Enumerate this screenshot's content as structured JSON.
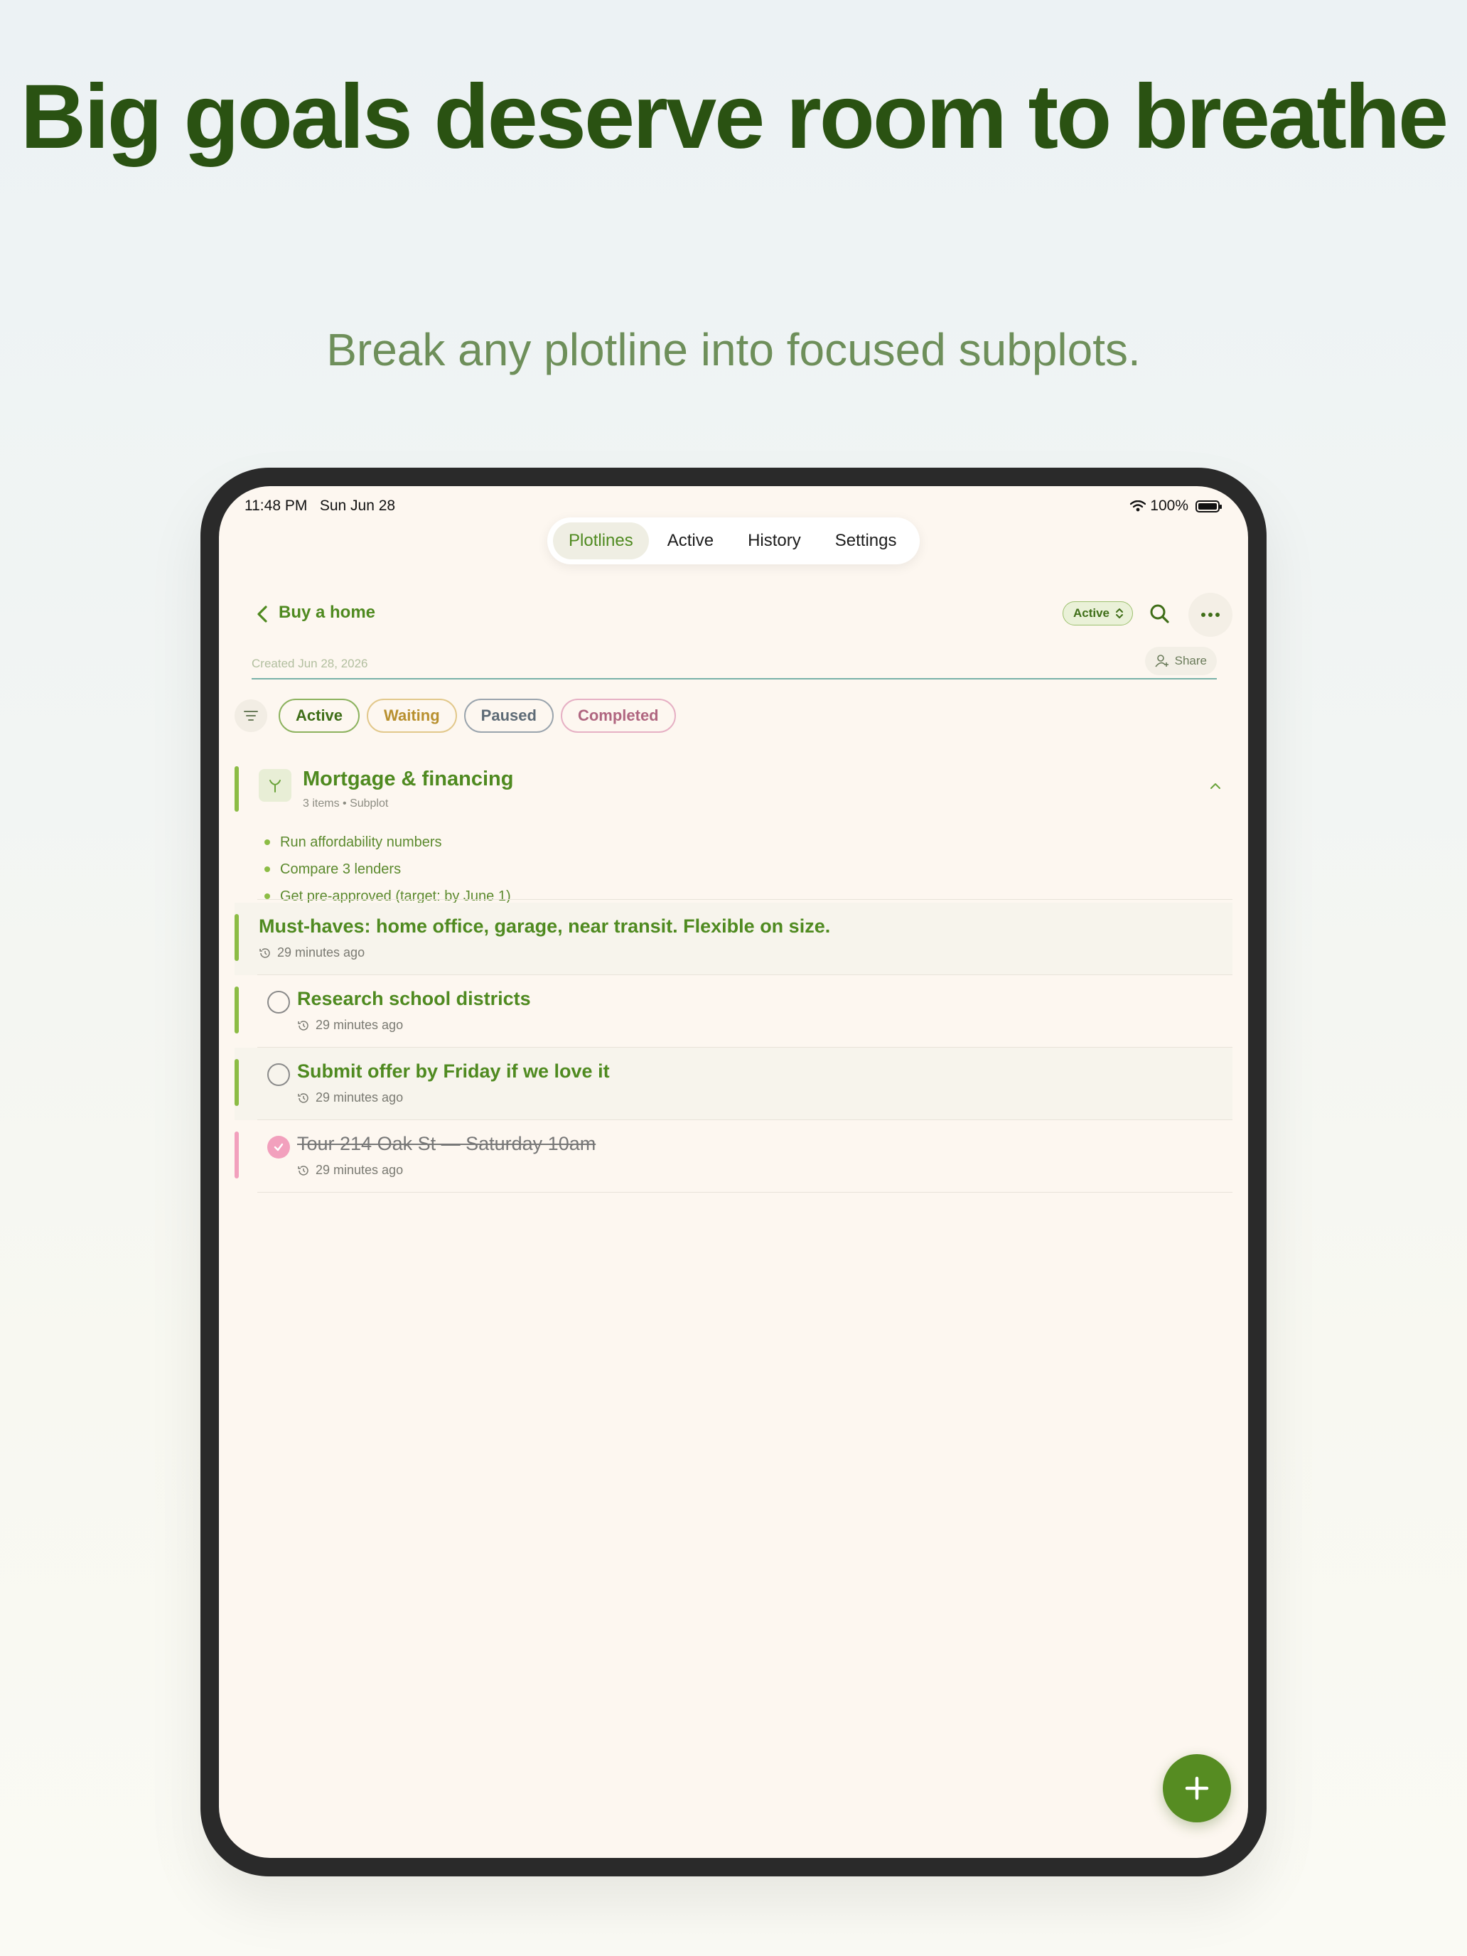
{
  "hero": {
    "headline": "Big goals deserve room to breathe",
    "subheadline": "Break any plotline into focused subplots."
  },
  "status_bar": {
    "time": "11:48 PM",
    "date": "Sun Jun 28",
    "battery": "100%"
  },
  "tabs": [
    {
      "label": "Plotlines",
      "active": true
    },
    {
      "label": "Active"
    },
    {
      "label": "History"
    },
    {
      "label": "Settings"
    }
  ],
  "header": {
    "back_title": "Buy a home",
    "status": "Active",
    "created": "Created Jun 28, 2026",
    "share_label": "Share"
  },
  "filters": [
    "Active",
    "Waiting",
    "Paused",
    "Completed"
  ],
  "subplot": {
    "title": "Mortgage & financing",
    "meta": "3 items • Subplot",
    "items": [
      "Run affordability numbers",
      "Compare 3 lenders",
      "Get pre-approved (target: by June 1)"
    ]
  },
  "entries": [
    {
      "title": "Must-haves: home office, garage, near transit. Flexible on size.",
      "time": "29 minutes ago",
      "kind": "note"
    },
    {
      "title": "Research school districts",
      "time": "29 minutes ago",
      "kind": "task"
    },
    {
      "title": "Submit offer by Friday if we love it",
      "time": "29 minutes ago",
      "kind": "task"
    },
    {
      "title": "Tour 214 Oak St — Saturday 10am",
      "time": "29 minutes ago",
      "kind": "done"
    }
  ],
  "colors": {
    "brand_green": "#4f8a20",
    "headline": "#2a5212",
    "completed_pink": "#f2a0bd"
  }
}
